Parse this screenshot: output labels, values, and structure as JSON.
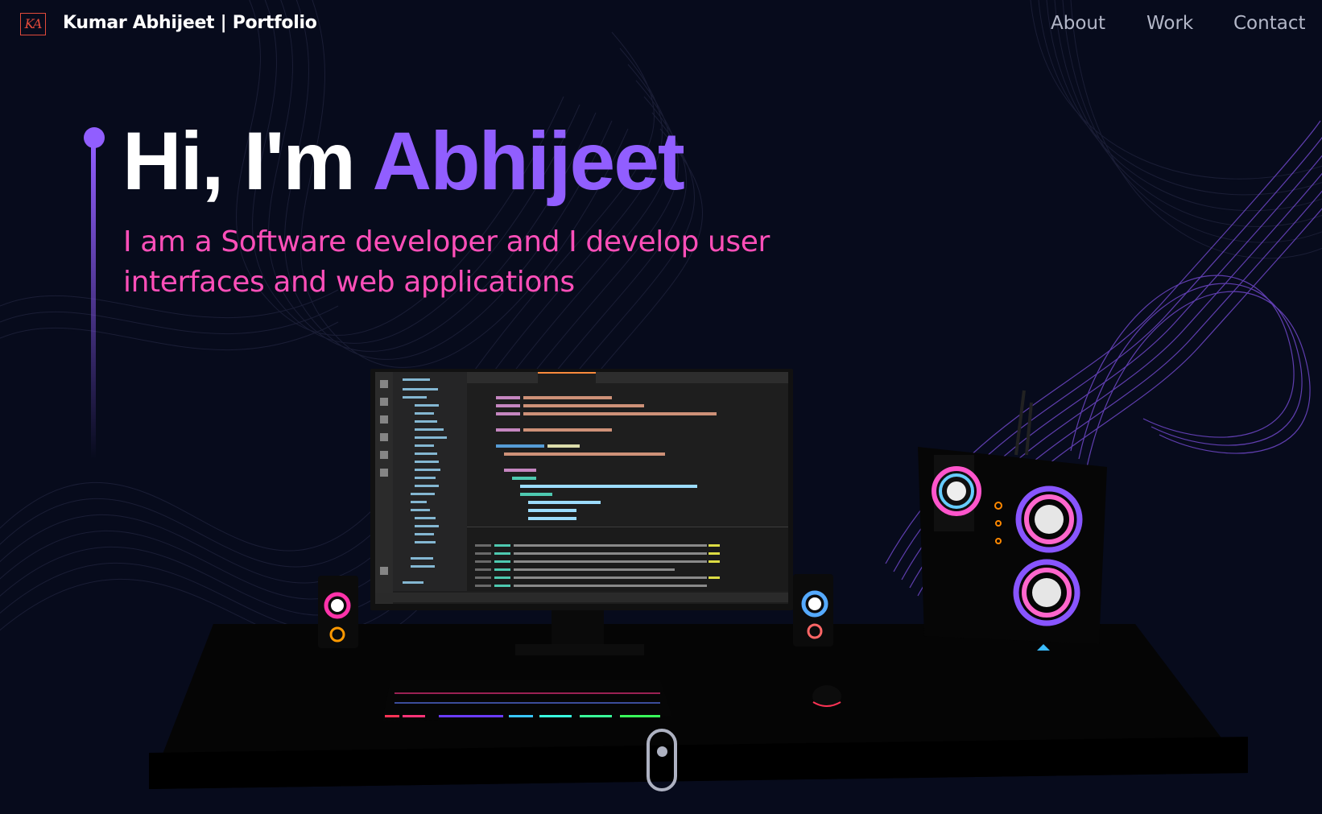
{
  "navbar": {
    "logo_text": "KA",
    "brand": "Kumar Abhijeet  | Portfolio",
    "links": [
      {
        "label": "About"
      },
      {
        "label": "Work"
      },
      {
        "label": "Contact"
      }
    ]
  },
  "hero": {
    "greeting": "Hi, I'm ",
    "name": "Abhijeet",
    "subtitle": "I am a Software developer and I develop user interfaces and web applications"
  },
  "colors": {
    "background": "#070b1c",
    "accent": "#915eff",
    "subtitle": "#ff4fb9",
    "nav_text": "#b3b7c8"
  },
  "icons": {
    "logo": "ka-monogram-icon",
    "scroll": "mouse-scroll-icon"
  }
}
